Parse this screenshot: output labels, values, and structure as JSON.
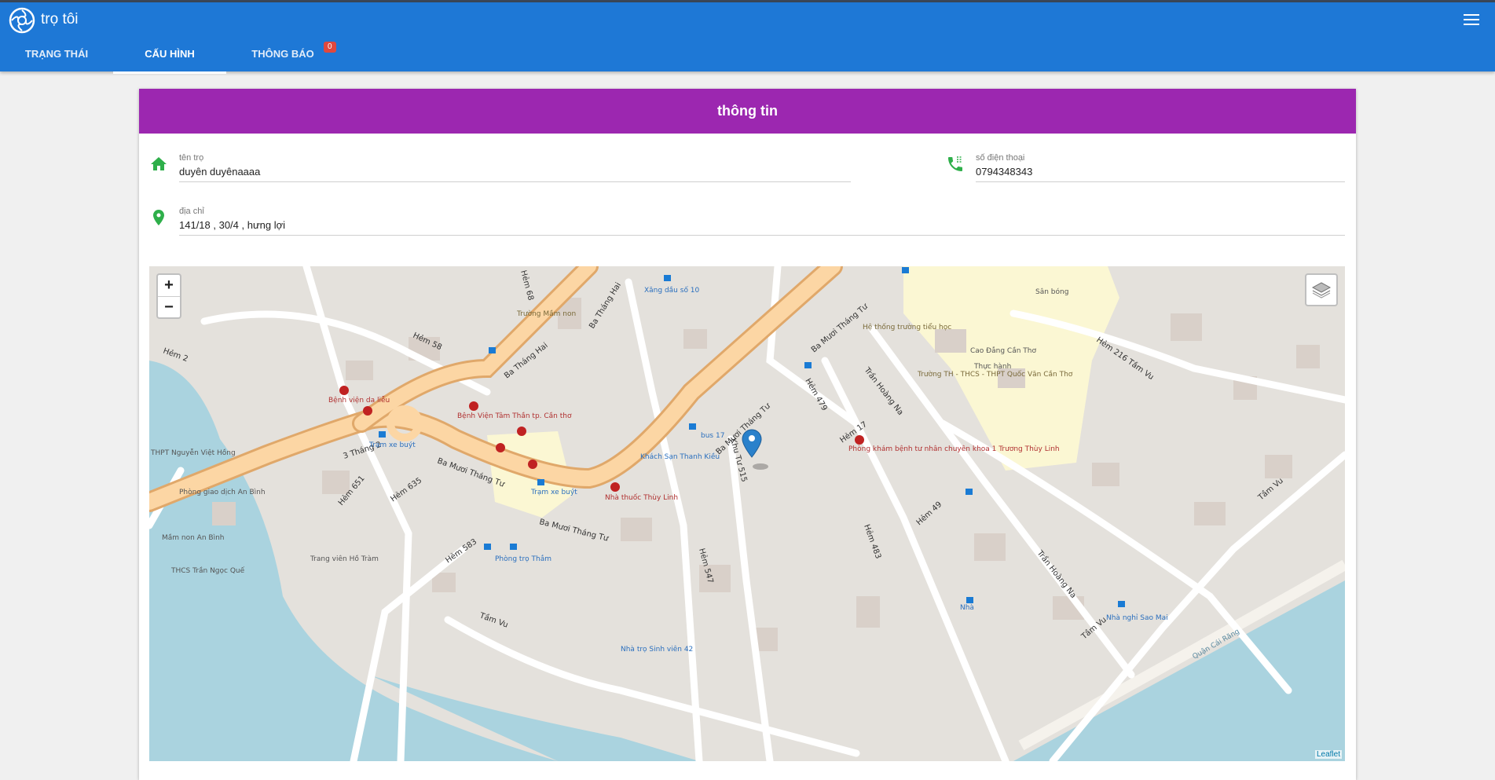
{
  "app": {
    "title": "trọ tôi"
  },
  "tabs": [
    {
      "label": "TRẠNG THÁI"
    },
    {
      "label": "CẤU HÌNH"
    },
    {
      "label": "THÔNG BÁO",
      "badge": "0"
    }
  ],
  "card": {
    "title": "thông tin",
    "fields": {
      "name": {
        "label": "tên trọ",
        "value": "duyên duyênaaaa"
      },
      "phone": {
        "label": "số điện thoại",
        "value": "0794348343"
      },
      "address": {
        "label": "địa chỉ",
        "value": "141/18 , 30/4 , hưng lợi"
      }
    }
  },
  "map": {
    "zoom_in": "+",
    "zoom_out": "−",
    "attribution": "Leaflet",
    "labels": [
      "Ba Tháng Hai",
      "Ba Mươi Tháng Tư",
      "3 Tháng 2",
      "Hẻm 58",
      "Hẻm 2",
      "Hẻm 479",
      "Hẻm 17",
      "Trần Hoàng Na",
      "Hẻm 216 Tầm Vu",
      "Tầm Vu",
      "Hẻm 547",
      "Hẻm 483",
      "Hẻm 49",
      "Hẻm 583",
      "Hẻm 635",
      "Hẻm 651",
      "Hẻm 68",
      "Khu Tư 515",
      "Bệnh viện da liễu",
      "Bệnh Viện Tâm Thần tp. Cần thơ",
      "Trạm xe buýt",
      "Xăng dầu số 10",
      "Trường Mầm non",
      "Hệ thống trường tiểu học",
      "Cao Đẳng Cần Thơ",
      "Thực hành",
      "Trường TH - THCS - THPT Quốc Văn Cần Thơ",
      "Sân bóng",
      "Phòng khám bệnh tư nhân chuyên khoa 1 Trương Thùy Linh",
      "Nhà thuốc Thùy Linh",
      "Khách Sạn Thanh Kiều",
      "bus 17",
      "THPT Nguyễn Việt Hồng",
      "Phòng giao dịch An Bình",
      "Mầm non An Bình",
      "THCS Trần Ngọc Quế",
      "Phòng trọ Thắm",
      "Trang viên Hồ Tràm",
      "Nhà trọ Sinh viên 42",
      "Nhà nghỉ Sao Mai",
      "Nhà",
      "Quận Cái Răng"
    ]
  },
  "colors": {
    "appbar": "#1e78d6",
    "card_header": "#9c27b0",
    "icon_green": "#2eaf4a"
  }
}
